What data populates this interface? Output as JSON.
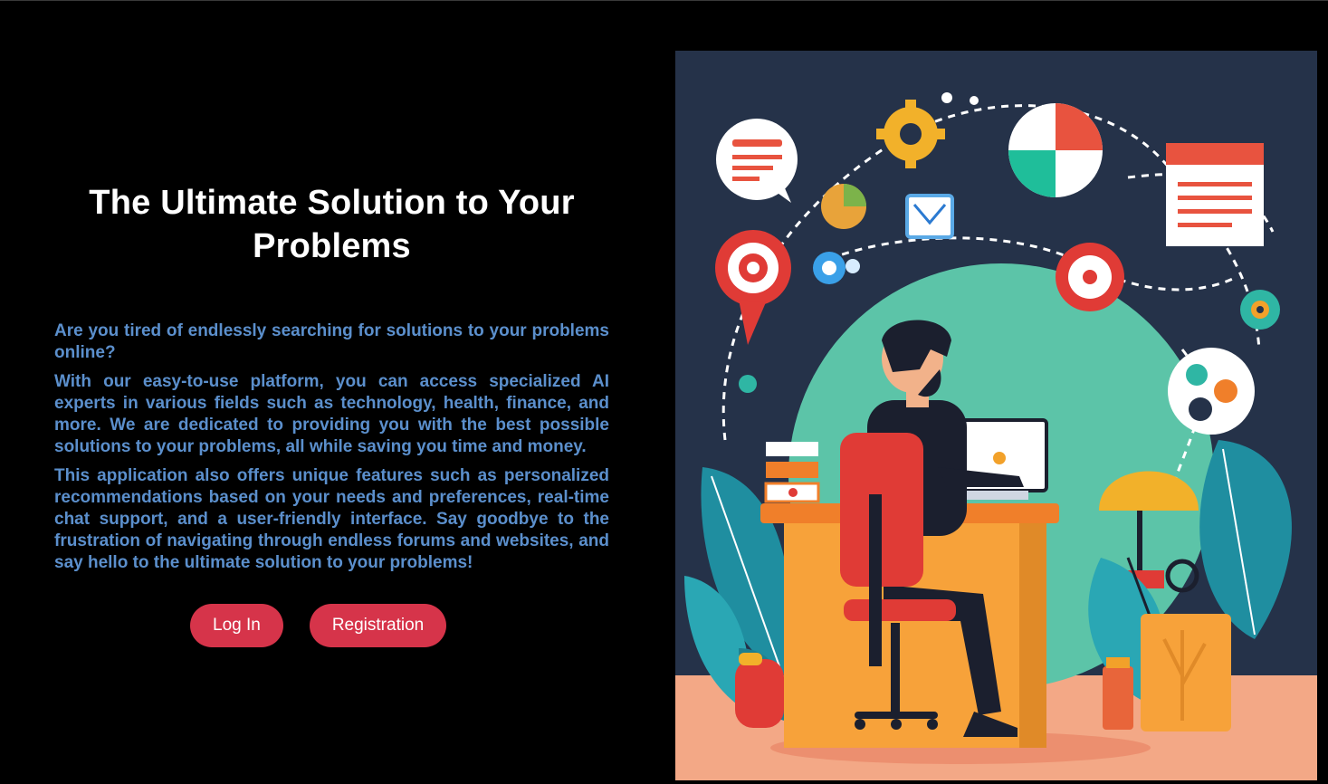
{
  "hero": {
    "title": "The Ultimate Solution to Your Problems",
    "paragraphs": [
      "Are you tired of endlessly searching for solutions to your problems online?",
      "With our easy-to-use platform, you can access specialized AI experts in various fields such as technology, health, finance, and more. We are dedicated to providing you with the best possible solutions to your problems, all while saving you time and money.",
      "This application also offers unique features such as personalized recommendations based on your needs and preferences, real-time chat support, and a user-friendly interface. Say goodbye to the frustration of navigating through endless forums and websites, and say hello to the ultimate solution to your problems!"
    ]
  },
  "actions": {
    "login_label": "Log In",
    "register_label": "Registration"
  },
  "colors": {
    "background": "#000000",
    "title": "#ffffff",
    "body_text": "#5b8fcc",
    "button": "#d6344a"
  }
}
